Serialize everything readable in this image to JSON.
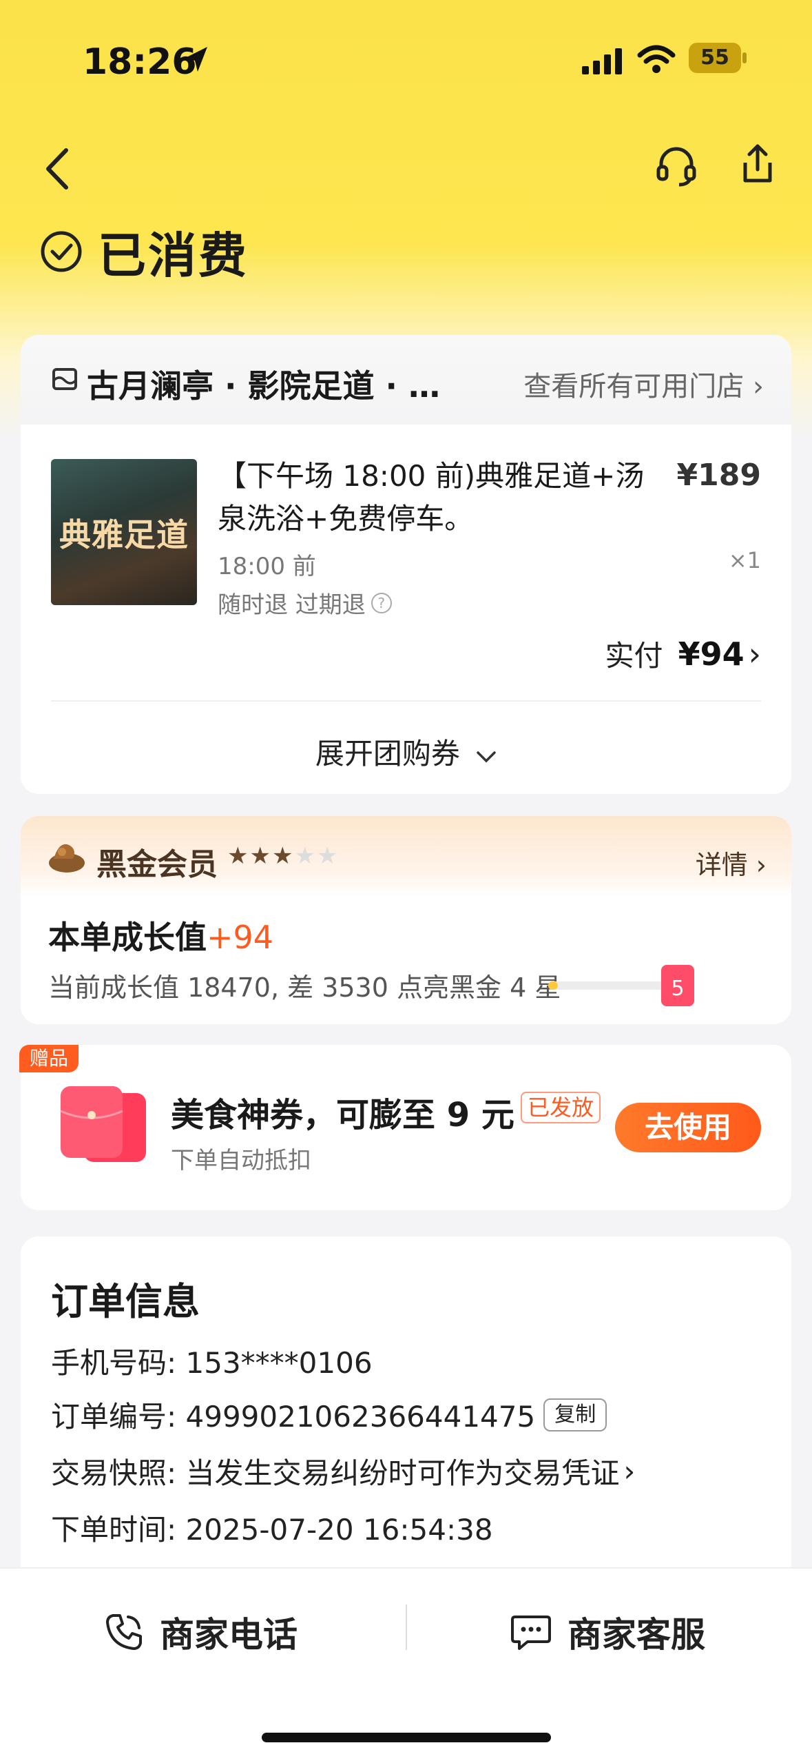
{
  "status_bar": {
    "time": "18:26",
    "battery": "55"
  },
  "header": {
    "status_text": "已消费"
  },
  "shop": {
    "name": "古月澜亭 · 影院足道 · …",
    "all_stores": "查看所有可用门店"
  },
  "product": {
    "thumb_text": "典雅足道",
    "title": "【下午场 18:00 前)典雅足道+汤泉洗浴+免费停车。",
    "price": "¥189",
    "time_note": "18:00 前",
    "qty": "×1",
    "refund": "随时退 过期退",
    "paid_label": "实付",
    "paid_value": "¥94",
    "expand_label": "展开团购券"
  },
  "member": {
    "title": "黑金会员",
    "stars_on": 3,
    "stars_total": 5,
    "detail": "详情",
    "growth_label": "本单成长值",
    "growth_plus": "+94",
    "growth_sub": "当前成长值 18470, 差 3530 点亮黑金 4 星",
    "progress": 0.08,
    "redpack_num": "5"
  },
  "gift": {
    "tag": "赠品",
    "title": "美食神券，可膨至 9 元",
    "badge": "已发放",
    "subtitle": "下单自动抵扣",
    "button": "去使用"
  },
  "order": {
    "title": "订单信息",
    "phone": "手机号码: 153****0106",
    "number": "订单编号: 4999021062366441475",
    "copy": "复制",
    "snapshot": "交易快照: 当发生交易纠纷时可作为交易凭证",
    "time": "下单时间: 2025-07-20 16:54:38"
  },
  "bottom": {
    "phone_label": "商家电话",
    "service_label": "商家客服"
  },
  "colors": {
    "accent": "#FFD93A",
    "orange": "#FF5A1F"
  }
}
